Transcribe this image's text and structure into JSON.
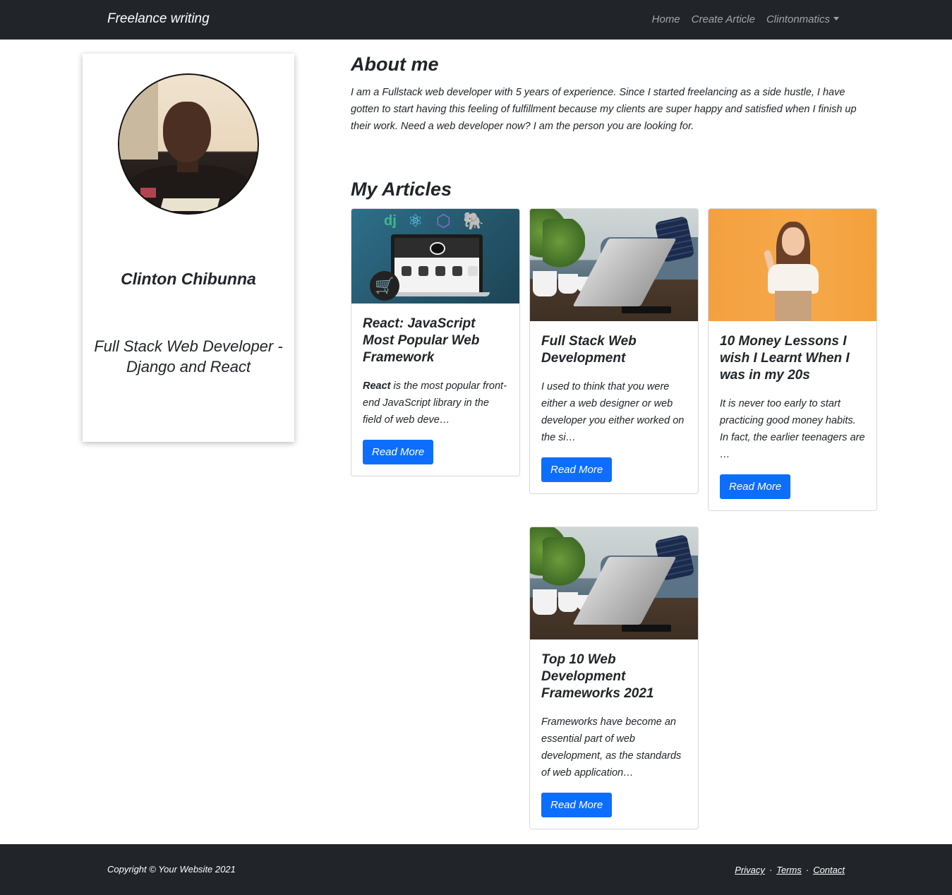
{
  "navbar": {
    "brand": "Freelance writing",
    "links": [
      "Home",
      "Create Article"
    ],
    "user_menu": "Clintonmatics"
  },
  "profile": {
    "name": "Clinton Chibunna",
    "role": "Full Stack Web Developer - Django and React"
  },
  "about": {
    "title": "About me",
    "text": "I am a Fullstack web developer with 5 years of experience. Since I started freelancing as a side hustle, I have gotten to start having this feeling of fulfillment because my clients are super happy and satisfied when I finish up their work. Need a web developer now? I am the person you are looking for."
  },
  "articles_title": "My Articles",
  "articles": [
    {
      "title": "React: JavaScript Most Popular Web Framework",
      "lead_bold": "React",
      "text": " is the most popular front-end JavaScript library in the field of web deve…",
      "button": "Read More"
    },
    {
      "title": "Full Stack Web Development",
      "text": "I used to think that you were either a web designer or web developer you either worked on the si…",
      "button": "Read More"
    },
    {
      "title": "10 Money Lessons I wish I Learnt When I was in my 20s",
      "text": "It is never too early to start practicing good money habits. In fact, the earlier teenagers are …",
      "button": "Read More"
    },
    {
      "title": "Top 10 Web Development Frameworks 2021",
      "text": "Frameworks have become an essential part of web development, as the standards of web application…",
      "button": "Read More"
    }
  ],
  "footer": {
    "copyright": "Copyright © Your Website 2021",
    "links": [
      "Privacy",
      "Terms",
      "Contact"
    ],
    "separator": "·"
  },
  "colors": {
    "navbar_bg": "#212529",
    "primary_button": "#0d6efd",
    "nav_link": "rgba(255,255,255,0.55)"
  },
  "icons": [
    "dropdown-caret-icon",
    "shopping-cart-icon",
    "django-logo-icon",
    "react-logo-icon",
    "graphql-logo-icon",
    "postgresql-logo-icon"
  ]
}
